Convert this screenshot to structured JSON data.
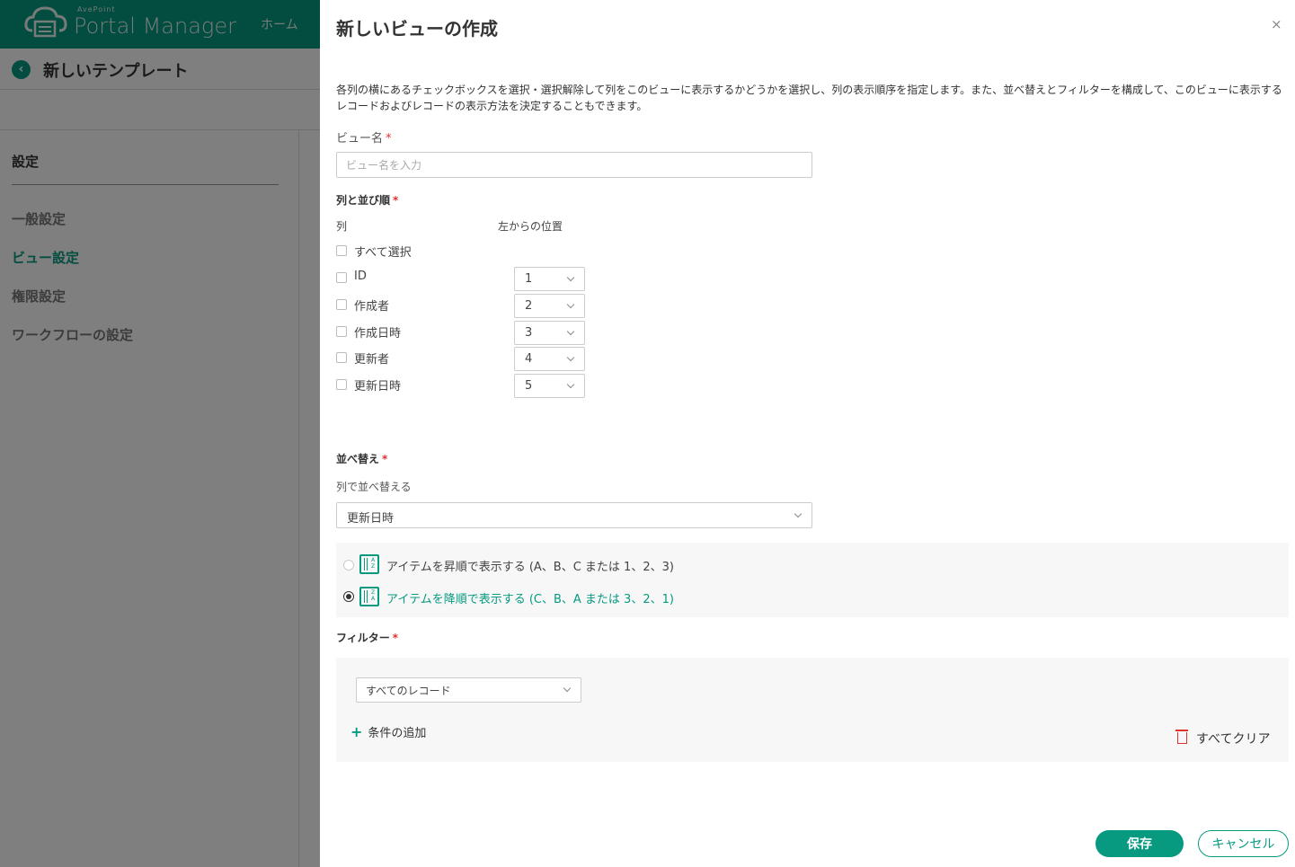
{
  "app": {
    "brand_small": "AvePoint",
    "brand": "Portal Manager",
    "nav_home": "ホーム",
    "page_title": "新しいテンプレート",
    "sidebar": {
      "heading": "設定",
      "items": [
        {
          "label": "一般設定",
          "active": false
        },
        {
          "label": "ビュー設定",
          "active": true
        },
        {
          "label": "権限設定",
          "active": false
        },
        {
          "label": "ワークフローの設定",
          "active": false
        }
      ]
    }
  },
  "panel": {
    "title": "新しいビューの作成",
    "close": "×",
    "description": "各列の横にあるチェックボックスを選択・選択解除して列をこのビューに表示するかどうかを選択し、列の表示順序を指定します。また、並べ替えとフィルターを構成して、このビューに表示するレコードおよびレコードの表示方法を決定することもできます。",
    "view_name": {
      "label": "ビュー名",
      "required": "*",
      "placeholder": "ビュー名を入力",
      "value": ""
    },
    "columns": {
      "label": "列と並び順",
      "required": "*",
      "col_header": "列",
      "pos_header": "左からの位置",
      "select_all": "すべて選択",
      "rows": [
        {
          "label": "ID",
          "position": "1",
          "checked": false
        },
        {
          "label": "作成者",
          "position": "2",
          "checked": false
        },
        {
          "label": "作成日時",
          "position": "3",
          "checked": false
        },
        {
          "label": "更新者",
          "position": "4",
          "checked": false
        },
        {
          "label": "更新日時",
          "position": "5",
          "checked": false
        }
      ]
    },
    "sort": {
      "label": "並べ替え",
      "required": "*",
      "by_label": "列で並べ替える",
      "by_value": "更新日時",
      "ascending_label": "アイテムを昇順で表示する (A、B、C または 1、2、3)",
      "descending_label": "アイテムを降順で表示する (C、B、A または 3、2、1)",
      "selected": "descending"
    },
    "filter": {
      "label": "フィルター",
      "required": "*",
      "select_value": "すべてのレコード",
      "add_condition": "条件の追加",
      "clear_all": "すべてクリア"
    },
    "buttons": {
      "save": "保存",
      "cancel": "キャンセル"
    }
  },
  "colors": {
    "accent": "#079a80",
    "required": "#e0312f"
  }
}
